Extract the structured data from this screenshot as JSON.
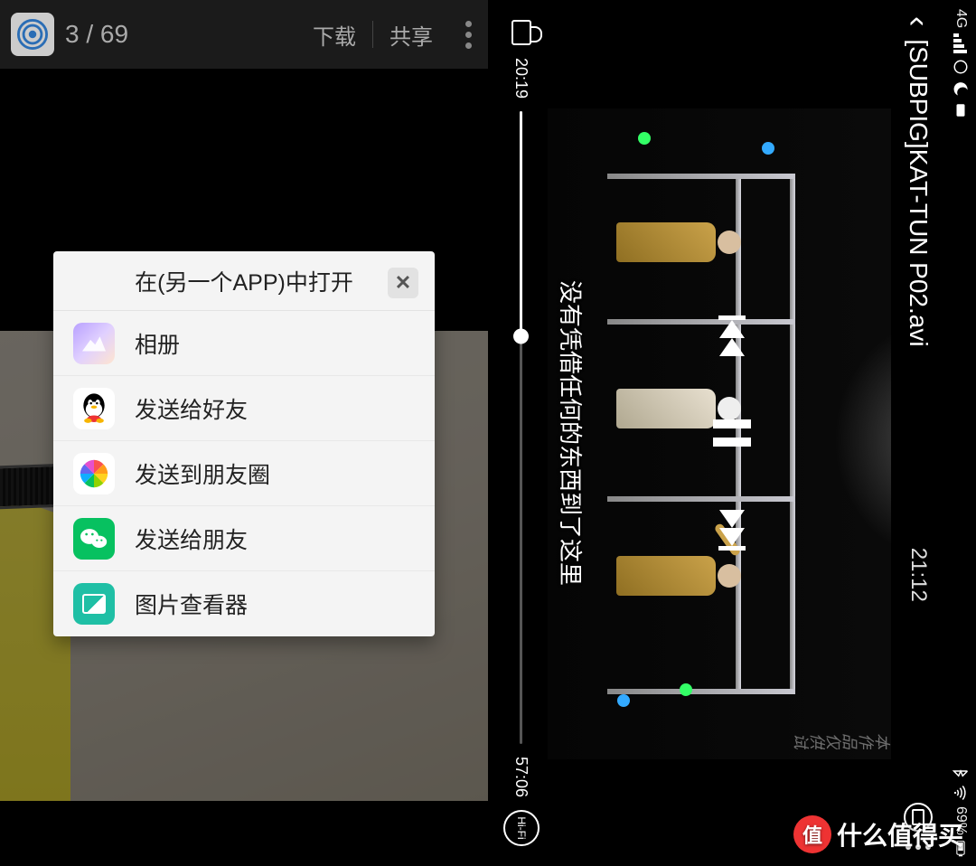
{
  "left": {
    "counter": "3 / 69",
    "download": "下载",
    "share": "共享"
  },
  "popup": {
    "title": "在(另一个APP)中打开",
    "close": "✕",
    "items": [
      {
        "label": "相册"
      },
      {
        "label": "发送给好友"
      },
      {
        "label": "发送到朋友圈"
      },
      {
        "label": "发送给朋友"
      },
      {
        "label": "图片查看器"
      }
    ]
  },
  "right": {
    "status": {
      "net": "4G",
      "battery": "69%"
    },
    "title": "[SUBPIG]KAT-TUN P02.avi",
    "center_time": "21:12",
    "watermark_side": "本作品仅供试",
    "subtitle": "没有凭借任何的东西到了这里",
    "t_cur": "20:19",
    "t_total": "57:06",
    "hifi": "Hi-Fi",
    "progress_pct": 35.6
  },
  "badge": {
    "char": "值",
    "text": "什么值得买"
  }
}
